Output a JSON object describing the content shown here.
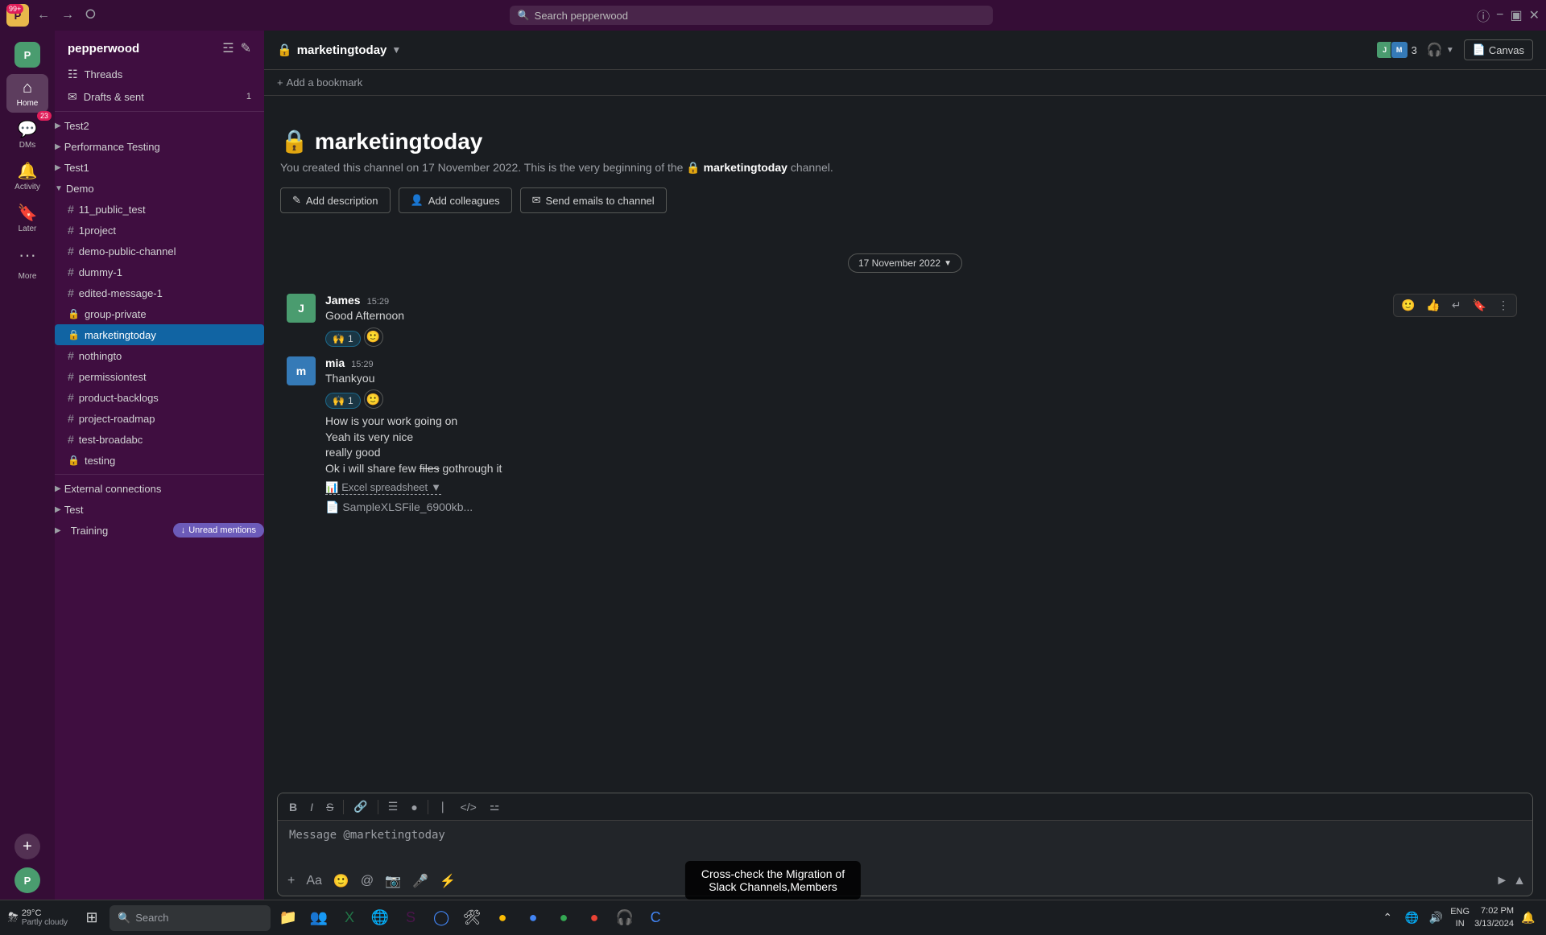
{
  "topbar": {
    "workspace_name": "pepperwood",
    "search_placeholder": "Search pepperwood",
    "badge": "99+",
    "nav_back": "←",
    "nav_forward": "→",
    "nav_history": "⊙"
  },
  "icon_bar": {
    "home_label": "Home",
    "dms_label": "DMs",
    "activity_label": "Activity",
    "later_label": "Later",
    "more_label": "More",
    "more_btn": "···",
    "add_btn": "+"
  },
  "sidebar": {
    "workspace_name": "pepperwood",
    "threads_label": "Threads",
    "drafts_sent_label": "Drafts & sent",
    "drafts_badge": "1",
    "channels": [
      {
        "name": "Test2",
        "type": "group",
        "collapse": true
      },
      {
        "name": "Performance Testing",
        "type": "group",
        "collapse": true
      },
      {
        "name": "Test1",
        "type": "group",
        "collapse": true
      },
      {
        "name": "Demo",
        "type": "group",
        "collapse": false
      },
      {
        "name": "11_public_test",
        "type": "hash"
      },
      {
        "name": "1project",
        "type": "hash"
      },
      {
        "name": "demo-public-channel",
        "type": "hash"
      },
      {
        "name": "dummy-1",
        "type": "hash"
      },
      {
        "name": "edited-message-1",
        "type": "hash"
      },
      {
        "name": "group-private",
        "type": "lock"
      },
      {
        "name": "marketingtoday",
        "type": "lock",
        "active": true
      },
      {
        "name": "nothingto",
        "type": "hash"
      },
      {
        "name": "permissiontest",
        "type": "hash"
      },
      {
        "name": "product-backlogs",
        "type": "hash"
      },
      {
        "name": "project-roadmap",
        "type": "hash"
      },
      {
        "name": "test-broadabc",
        "type": "hash"
      },
      {
        "name": "testing",
        "type": "lock"
      }
    ],
    "external_connections_label": "External connections",
    "test_label": "Test",
    "training_label": "Training",
    "unread_mentions_label": "Unread mentions"
  },
  "channel": {
    "name": "marketingtoday",
    "lock_icon": "🔒",
    "members_count": "3",
    "canvas_label": "Canvas",
    "bookmark_label": "Add a bookmark",
    "intro_title": "marketingtoday",
    "intro_desc": "You created this channel on 17 November 2022. This is the very beginning of the",
    "intro_channel_ref": "marketingtoday",
    "intro_desc_end": "channel.",
    "add_description_label": "Add description",
    "add_colleagues_label": "Add colleagues",
    "send_emails_label": "Send emails to channel",
    "date_divider": "17 November 2022"
  },
  "messages": [
    {
      "author": "James",
      "time": "15:29",
      "text": "Good Afternoon",
      "reaction_emoji": "🙌",
      "reaction_count": "1"
    },
    {
      "author": "mia",
      "time": "15:29",
      "text_lines": [
        "Thankyou",
        "How is your work going on",
        "Yeah its very nice",
        "really good",
        "Ok i will share few files gothrough it"
      ],
      "reaction_emoji": "🙌",
      "reaction_count": "1",
      "has_file": true,
      "file_label": "Excel spreadsheet"
    }
  ],
  "message_input": {
    "placeholder": "Message @marketingtoday"
  },
  "hover_actions": [
    "😊",
    "👍",
    "↩",
    "🔖",
    "⋯"
  ],
  "taskbar": {
    "weather_temp": "29°C",
    "weather_desc": "Partly cloudy",
    "search_label": "Search",
    "time": "7:02 PM",
    "date": "3/13/2024",
    "lang": "ENG\nIN"
  },
  "notification": {
    "text": "Cross-check the Migration of\nSlack Channels,Members"
  }
}
